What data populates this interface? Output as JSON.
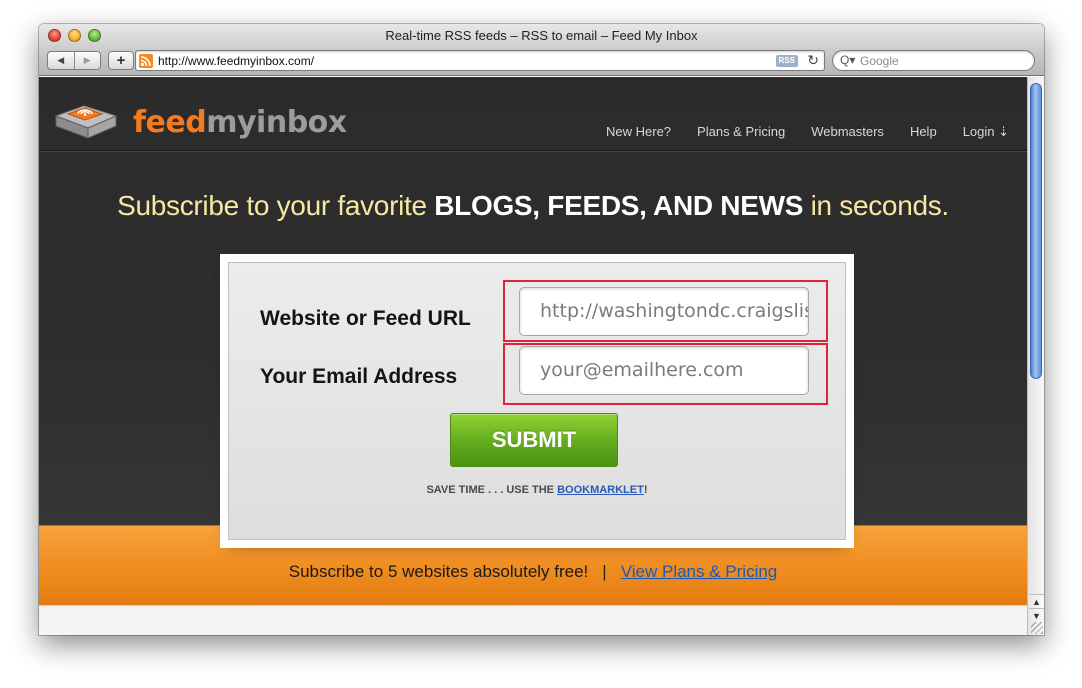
{
  "browser": {
    "window_title": "Real-time RSS feeds – RSS to email – Feed My Inbox",
    "back_label": "◀",
    "forward_label": "▶",
    "add_bookmark_label": "+",
    "address": "http://www.feedmyinbox.com/",
    "rss_badge": "RSS",
    "reload_label": "↻",
    "search_placeholder": "Google",
    "search_icon": "Q▾"
  },
  "site": {
    "logo_feed": "feed",
    "logo_rest": "myinbox",
    "nav": [
      {
        "label": "New Here?"
      },
      {
        "label": "Plans & Pricing"
      },
      {
        "label": "Webmasters"
      },
      {
        "label": "Help"
      },
      {
        "label": "Login ⇣"
      }
    ],
    "headline_prefix": "Subscribe to your favorite ",
    "headline_bold": "BLOGS, FEEDS, AND NEWS",
    "headline_suffix": " in seconds."
  },
  "form": {
    "url_label": "Website or Feed URL",
    "url_placeholder": "http://washingtondc.craigslist.org/",
    "email_label": "Your Email Address",
    "email_placeholder": "your@emailhere.com",
    "submit_label": "SUBMIT",
    "save_time_text": "SAVE TIME . . . USE THE ",
    "bookmarklet_link": "BOOKMARKLET",
    "save_time_end": "!"
  },
  "band": {
    "free_text": "Subscribe to 5 websites absolutely free!",
    "separator": "|",
    "pricing_link": "View Plans & Pricing"
  },
  "colors": {
    "brand_orange": "#f37a1f",
    "highlight_red": "#e0223b",
    "submit_green": "#5ea81c",
    "link_blue": "#1f57b5",
    "headline_yellow": "#f6e7a1"
  }
}
